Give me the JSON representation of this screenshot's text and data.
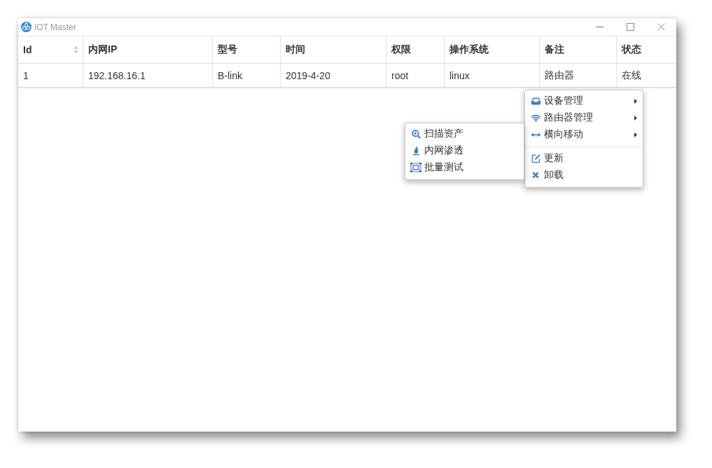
{
  "window": {
    "title": "IOT Master"
  },
  "table": {
    "columns": [
      {
        "label": "Id",
        "sortable": true
      },
      {
        "label": "内网IP",
        "sortable": false
      },
      {
        "label": "型号",
        "sortable": false
      },
      {
        "label": "时间",
        "sortable": false
      },
      {
        "label": "权限",
        "sortable": false
      },
      {
        "label": "操作系统",
        "sortable": false
      },
      {
        "label": "备注",
        "sortable": false
      },
      {
        "label": "状态",
        "sortable": false
      }
    ],
    "rows": [
      {
        "cells": [
          "1",
          "192.168.16.1",
          "B-link",
          "2019-4-20",
          "root",
          "linux",
          "路由器",
          "在线"
        ]
      }
    ]
  },
  "context_menu": {
    "groups": [
      {
        "items": [
          {
            "label": "设备管理",
            "submenu": true
          },
          {
            "label": "路由器管理",
            "submenu": true
          },
          {
            "label": "横向移动",
            "submenu": true
          }
        ]
      },
      {
        "items": [
          {
            "label": "更新",
            "submenu": false
          },
          {
            "label": "卸载",
            "submenu": false
          }
        ]
      }
    ]
  },
  "submenu": {
    "items": [
      {
        "label": "扫描资产"
      },
      {
        "label": "内网渗透"
      },
      {
        "label": "批量测试"
      }
    ]
  }
}
